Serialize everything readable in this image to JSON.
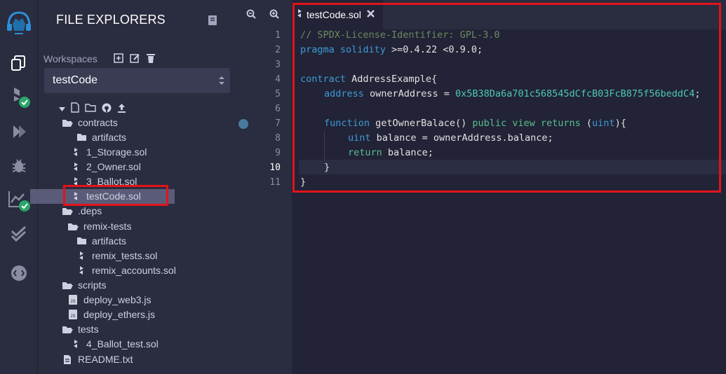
{
  "sidebar": {
    "icons": [
      "remix-logo-icon",
      "file-explorer-icon",
      "solidity-compiler-icon",
      "deploy-run-icon",
      "debugger-icon",
      "analysis-icon",
      "unit-testing-icon",
      "plugin-manager-icon"
    ]
  },
  "explorer": {
    "title": "FILE EXPLORERS",
    "workspaces_label": "Workspaces",
    "workspace_value": "testCode",
    "tree": [
      {
        "label": "contracts",
        "type": "folder-open"
      },
      {
        "label": "artifacts",
        "type": "folder"
      },
      {
        "label": "1_Storage.sol",
        "type": "sol"
      },
      {
        "label": "2_Owner.sol",
        "type": "sol"
      },
      {
        "label": "3_Ballot.sol",
        "type": "sol"
      },
      {
        "label": "testCode.sol",
        "type": "sol"
      },
      {
        "label": ".deps",
        "type": "folder-open"
      },
      {
        "label": "remix-tests",
        "type": "folder-open"
      },
      {
        "label": "artifacts",
        "type": "folder"
      },
      {
        "label": "remix_tests.sol",
        "type": "sol"
      },
      {
        "label": "remix_accounts.sol",
        "type": "sol"
      },
      {
        "label": "scripts",
        "type": "folder-open"
      },
      {
        "label": "deploy_web3.js",
        "type": "js"
      },
      {
        "label": "deploy_ethers.js",
        "type": "js"
      },
      {
        "label": "tests",
        "type": "folder-open"
      },
      {
        "label": "4_Ballot_test.sol",
        "type": "sol"
      },
      {
        "label": "README.txt",
        "type": "txt"
      }
    ]
  },
  "editor": {
    "tab_label": "testCode.sol",
    "current_line": 10,
    "line_numbers": [
      "1",
      "2",
      "3",
      "4",
      "5",
      "6",
      "7",
      "8",
      "9",
      "10",
      "11"
    ],
    "lines": {
      "l1": "// SPDX-License-Identifier: GPL-3.0",
      "l2_kw": "pragma solidity",
      "l2_rest": " >=0.4.22 <0.9.0;",
      "l4_kw": "contract",
      "l4_rest": " AddressExample{",
      "l5_kw": "address",
      "l5_mid": " ownerAddress = ",
      "l5_hex": "0x5B38Da6a701c568545dCfcB03FcB875f56beddC4",
      "l5_end": ";",
      "l7_kw": "function",
      "l7_name": " getOwnerBalace() ",
      "l7_mod": "public view returns",
      "l7_sp": " (",
      "l7_type": "uint",
      "l7_end": "){",
      "l8_kw": "uint",
      "l8_rest": " balance = ownerAddress.balance;",
      "l9_kw": "return",
      "l9_rest": " balance;",
      "l10": "}",
      "l11": "}"
    }
  }
}
